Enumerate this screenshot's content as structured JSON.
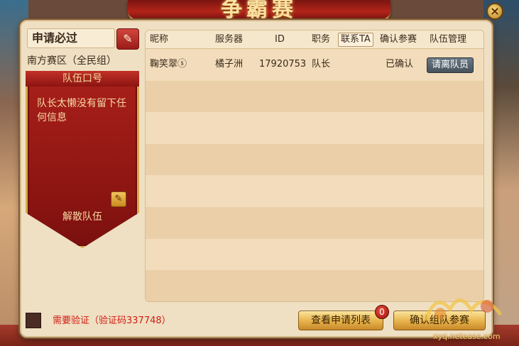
{
  "banner": {
    "title": "争霸赛"
  },
  "team": {
    "name": "申请必过",
    "region": "南方赛区（全民组）",
    "flag_header": "队伍口号",
    "slogan": "队长太懒没有留下任何信息",
    "disband_label": "解散队伍"
  },
  "table": {
    "headers": {
      "nickname": "昵称",
      "server": "服务器",
      "id": "ID",
      "role": "职务",
      "contact": "联系TA",
      "confirm": "确认参赛",
      "manage": "队伍管理"
    },
    "rows": [
      {
        "nickname": "鞠笑翠ⓢ",
        "server": "橘子洲",
        "id": "17920753",
        "role": "队长",
        "confirm": "已确认",
        "manage_btn": "请离队员"
      }
    ]
  },
  "bottom": {
    "verify_text": "需要验证（验证码337748）",
    "view_list_label": "查看申请列表",
    "view_list_count": "0",
    "confirm_label": "确认组队参赛"
  },
  "watermark": {
    "site": "xyq.netease.com"
  },
  "colors": {
    "accent_red": "#a9201a",
    "gold": "#d9a949",
    "verify_red": "#d11c10"
  }
}
